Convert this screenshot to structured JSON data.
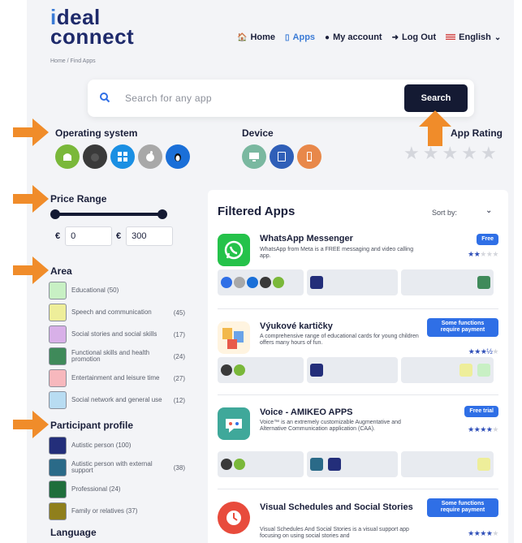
{
  "header": {
    "logo_top": "deal",
    "logo_bottom": "connect",
    "nav": [
      {
        "label": "Home",
        "icon": "home-icon"
      },
      {
        "label": "Apps",
        "icon": "phone-icon",
        "active": true
      },
      {
        "label": "My account",
        "icon": "user-icon"
      },
      {
        "label": "Log Out",
        "icon": "logout-icon"
      },
      {
        "label": "English",
        "icon": "flag-icon"
      }
    ],
    "breadcrumb": "Home / Find Apps"
  },
  "search": {
    "placeholder": "Search for any app",
    "button": "Search"
  },
  "filters": {
    "os_label": "Operating system",
    "os": [
      "android-icon",
      "ios-icon",
      "windows-icon",
      "mac-icon",
      "linux-icon"
    ],
    "device_label": "Device",
    "devices": [
      "desktop-icon",
      "tablet-icon",
      "smartphone-icon"
    ],
    "rating_label": "App Rating",
    "rating_stars": 5
  },
  "price": {
    "label": "Price Range",
    "currency": "€",
    "min": "0",
    "max": "300"
  },
  "area": {
    "label": "Area",
    "items": [
      {
        "label": "Educational",
        "count": "(50)",
        "color": "#c8f0c4"
      },
      {
        "label": "Speech and communication",
        "count": "(45)",
        "color": "#eeee9a"
      },
      {
        "label": "Social stories and social skills",
        "count": "(17)",
        "color": "#d8b0e8"
      },
      {
        "label": "Functional skills and health promotion",
        "count": "(24)",
        "color": "#3f8a5a"
      },
      {
        "label": "Entertainment and leisure time",
        "count": "(27)",
        "color": "#f7b8bd"
      },
      {
        "label": "Social network and general use",
        "count": "(12)",
        "color": "#b8dcf2"
      }
    ]
  },
  "participant": {
    "label": "Participant profile",
    "items": [
      {
        "label": "Autistic person (100)",
        "count": "",
        "color": "#232e7a"
      },
      {
        "label": "Autistic person with external support",
        "count": "(38)",
        "color": "#2a6a88"
      },
      {
        "label": "Professional (24)",
        "count": "",
        "color": "#1f6e3c"
      },
      {
        "label": "Family or relatives (37)",
        "count": "",
        "color": "#8f7f1c"
      }
    ]
  },
  "language_label": "Language",
  "apps": {
    "title": "Filtered Apps",
    "sort_label": "Sort by:",
    "items": [
      {
        "name": "WhatsApp Messenger",
        "desc": "WhatsApp from Meta is a FREE messaging and video calling app.",
        "badge": "Free",
        "rating": 2,
        "logo_color": "#25c24a",
        "logo_icon": "whatsapp-icon"
      },
      {
        "name": "Výukové kartičky",
        "desc": "A comprehensive range of educational cards for young children offers many hours of fun.",
        "badge": "Some functions require payment",
        "rating": 3.5,
        "logo_color": "#fff4e0",
        "logo_icon": "cards-icon"
      },
      {
        "name": "Voice - AMIKEO APPS",
        "desc": "Voice™ is an extremely customizable Augmentative and Alternative Communication application (CAA).",
        "badge": "Free trial",
        "rating": 4,
        "logo_color": "#3fa89a",
        "logo_icon": "voice-icon"
      },
      {
        "name": "Visual Schedules and Social Stories",
        "desc": "Visual Schedules And Social Stories is a visual support app focusing on using social stories and",
        "badge": "Some functions require payment",
        "rating": 4,
        "logo_color": "#e84b3c",
        "logo_icon": "schedule-icon"
      }
    ]
  },
  "colors": {
    "dark": "#141a33",
    "accent": "#2f6fe6",
    "arrow": "#f08c2a"
  }
}
